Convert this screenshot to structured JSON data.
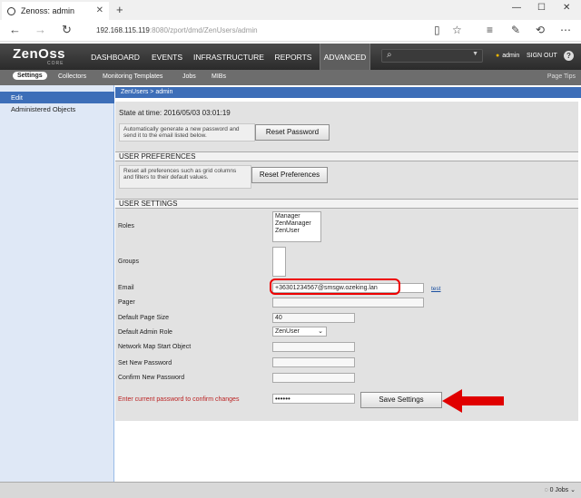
{
  "browser": {
    "tab_title": "Zenoss: admin",
    "url_host": "192.168.115.119",
    "url_rest": ":8080/zport/dmd/ZenUsers/admin"
  },
  "zenoss": {
    "logo": "ZenOss",
    "logo_sub": "CORE",
    "nav": [
      "DASHBOARD",
      "EVENTS",
      "INFRASTRUCTURE",
      "REPORTS",
      "ADVANCED"
    ],
    "user": "admin",
    "signout": "SIGN OUT",
    "help": "?"
  },
  "subnav": {
    "items": [
      "Settings",
      "Collectors",
      "Monitoring Templates",
      "Jobs",
      "MIBs"
    ],
    "page_tips": "Page Tips"
  },
  "sidebar": {
    "items": [
      "Edit",
      "Administered Objects"
    ]
  },
  "main": {
    "breadcrumb": "ZenUsers > admin",
    "state": "State at time: 2016/05/03 03:01:19",
    "reset_password_desc": "Automatically generate a new password and send it to the email listed below.",
    "reset_password_btn": "Reset Password",
    "user_prefs_head": "USER PREFERENCES",
    "reset_prefs_desc": "Reset all preferences such as grid columns and filters to their default values.",
    "reset_prefs_btn": "Reset Preferences",
    "user_settings_head": "USER SETTINGS",
    "labels": {
      "roles": "Roles",
      "groups": "Groups",
      "email": "Email",
      "pager": "Pager",
      "default_page_size": "Default Page Size",
      "default_admin_role": "Default Admin Role",
      "network_map": "Network Map Start Object",
      "set_new_password": "Set New Password",
      "confirm_new_password": "Confirm New Password",
      "enter_current": "Enter current password to confirm changes"
    },
    "roles": [
      "Manager",
      "ZenManager",
      "ZenUser"
    ],
    "email_value": "+36301234567@smsgw.ozeking.lan",
    "email_test": "test",
    "page_size_value": "40",
    "admin_role_value": "ZenUser",
    "current_password_mask": "••••••",
    "save_btn": "Save Settings"
  },
  "statusbar": {
    "jobs": "0 Jobs"
  },
  "colors": {
    "accent": "#3d6eb8",
    "highlight_red": "#e00000"
  }
}
